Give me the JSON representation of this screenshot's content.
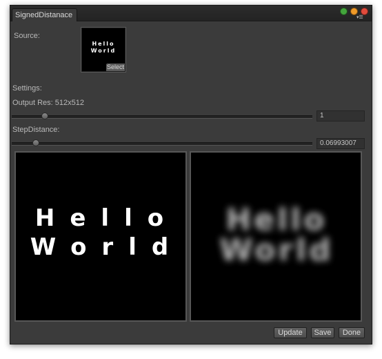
{
  "window": {
    "tab_title": "SignedDistanace",
    "controls": [
      {
        "name": "green-dot",
        "color": "#43a53c"
      },
      {
        "name": "orange-dot",
        "color": "#f09a28"
      },
      {
        "name": "red-dot",
        "color": "#e24b3c"
      }
    ],
    "menu_icon": "▾☰"
  },
  "source": {
    "label": "Source:",
    "thumb_text": "Hello\nWorld",
    "select_label": "Select"
  },
  "settings": {
    "label": "Settings:",
    "output_res_label": "Output Res: 512x512",
    "output_res_value": "1",
    "output_res_slider_fraction": 0.11,
    "step_distance_label": "StepDistance:",
    "step_distance_value": "0.06993007",
    "step_distance_slider_fraction": 0.07
  },
  "previews": {
    "left_text": "Hello\nWorld",
    "right_text": "Hello\nWorld"
  },
  "buttons": {
    "update": "Update",
    "save": "Save",
    "done": "Done"
  }
}
